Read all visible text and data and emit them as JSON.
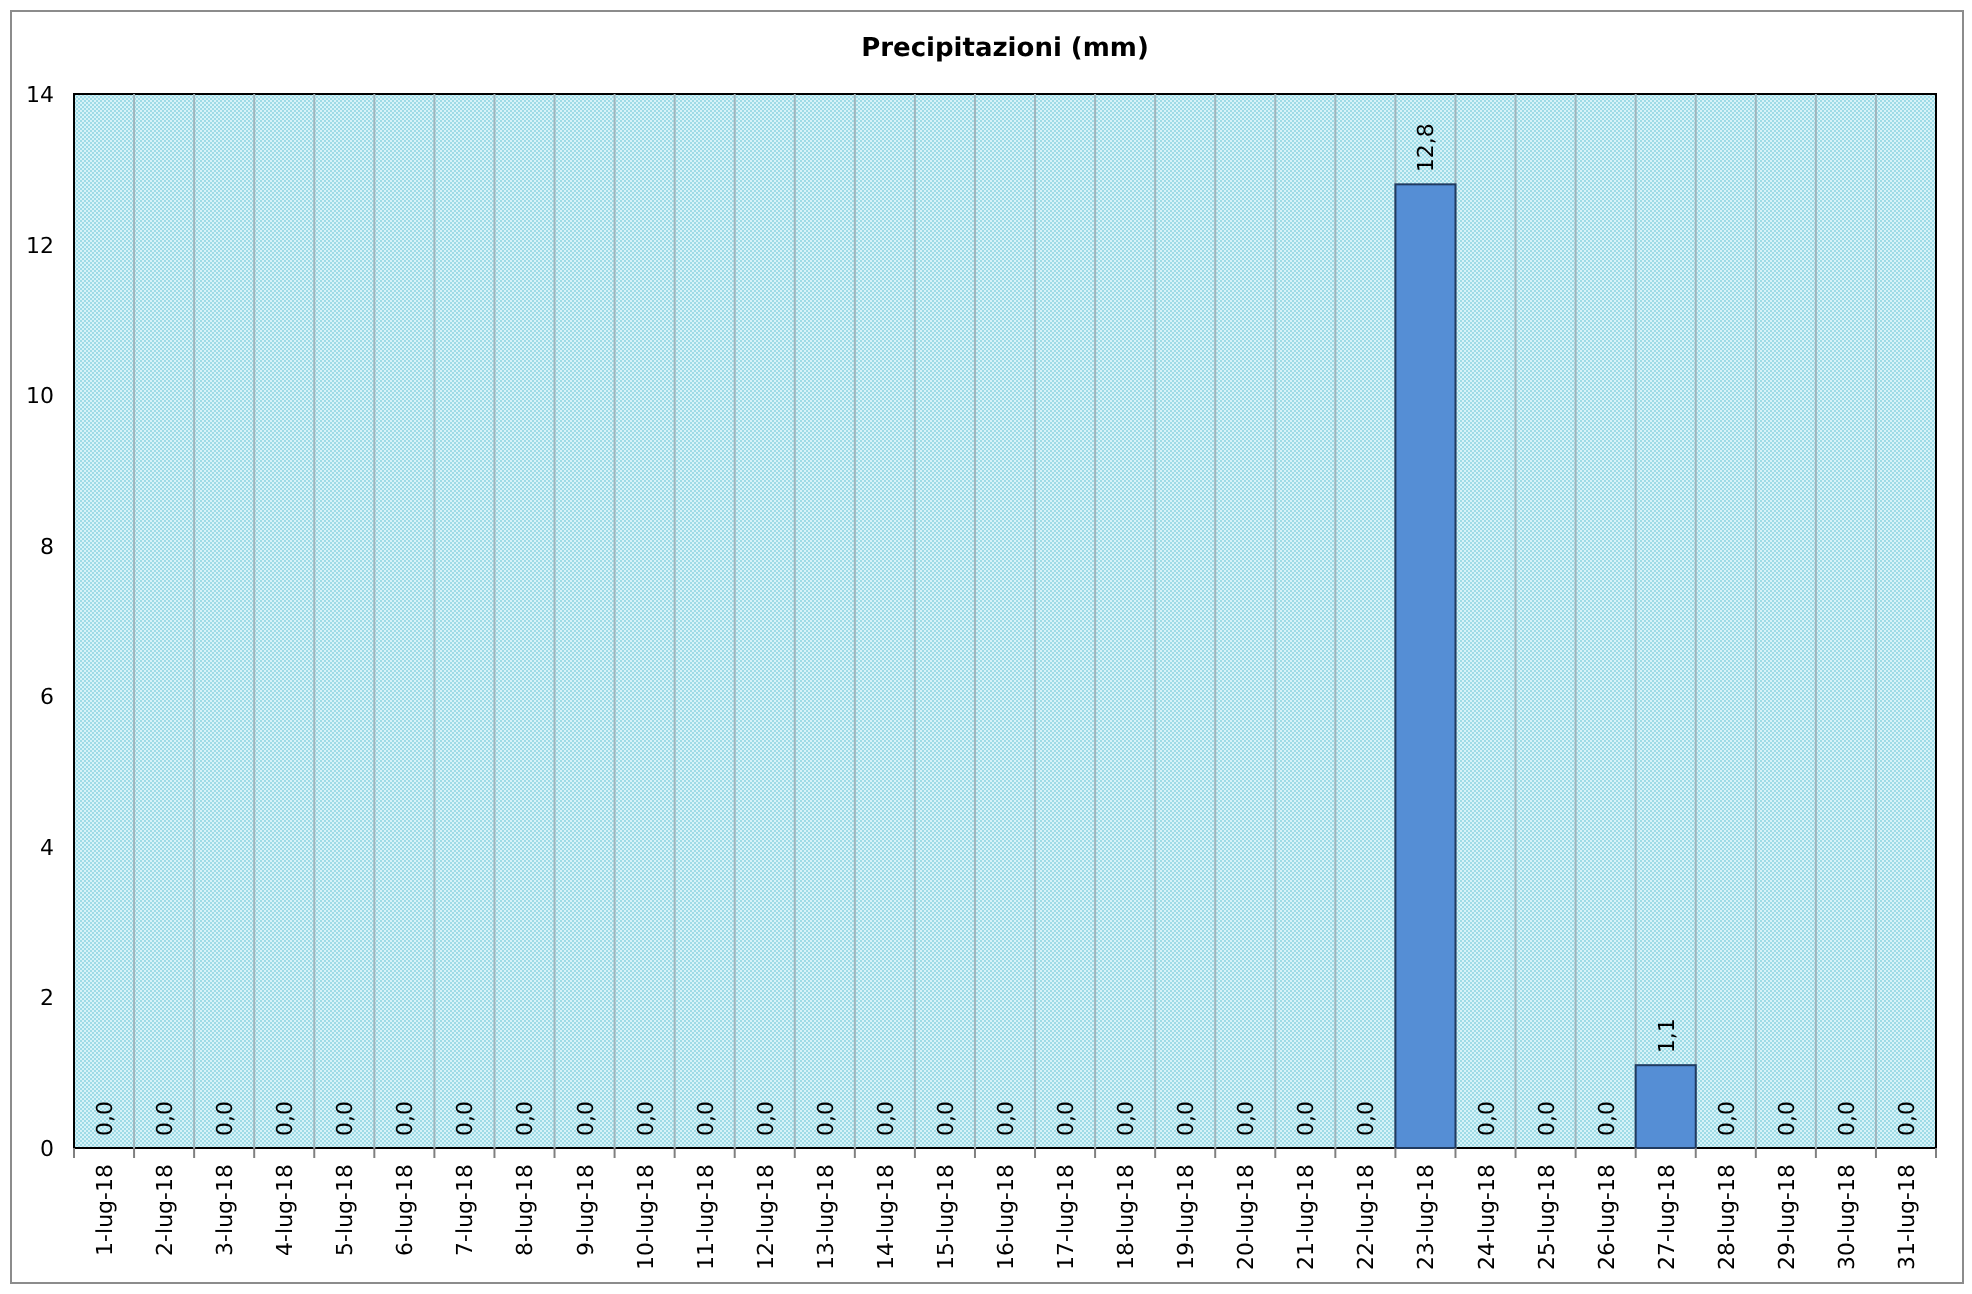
{
  "chart": {
    "chart_data": {
      "type": "bar",
      "title": "Precipitazioni (mm)",
      "categories": [
        "1-lug-18",
        "2-lug-18",
        "3-lug-18",
        "4-lug-18",
        "5-lug-18",
        "6-lug-18",
        "7-lug-18",
        "8-lug-18",
        "9-lug-18",
        "10-lug-18",
        "11-lug-18",
        "12-lug-18",
        "13-lug-18",
        "14-lug-18",
        "15-lug-18",
        "16-lug-18",
        "17-lug-18",
        "18-lug-18",
        "19-lug-18",
        "20-lug-18",
        "21-lug-18",
        "22-lug-18",
        "23-lug-18",
        "24-lug-18",
        "25-lug-18",
        "26-lug-18",
        "27-lug-18",
        "28-lug-18",
        "29-lug-18",
        "30-lug-18",
        "31-lug-18"
      ],
      "series": [
        {
          "color": "#558ed5",
          "values": [
            0,
            0,
            0,
            0,
            0,
            0,
            0,
            0,
            0,
            0,
            0,
            0,
            0,
            0,
            0,
            0,
            0,
            0,
            0,
            0,
            0,
            0,
            12.8,
            0,
            0,
            0,
            1.1,
            0,
            0,
            0,
            0
          ]
        }
      ],
      "value_labels": [
        "0,0",
        "0,0",
        "0,0",
        "0,0",
        "0,0",
        "0,0",
        "0,0",
        "0,0",
        "0,0",
        "0,0",
        "0,0",
        "0,0",
        "0,0",
        "0,0",
        "0,0",
        "0,0",
        "0,0",
        "0,0",
        "0,0",
        "0,0",
        "0,0",
        "0,0",
        "12,8",
        "0,0",
        "0,0",
        "0,0",
        "1,1",
        "0,0",
        "0,0",
        "0,0",
        "0,0"
      ],
      "ylim": [
        0,
        14
      ],
      "yticks": [
        0,
        2,
        4,
        6,
        8,
        10,
        12,
        14
      ]
    }
  }
}
